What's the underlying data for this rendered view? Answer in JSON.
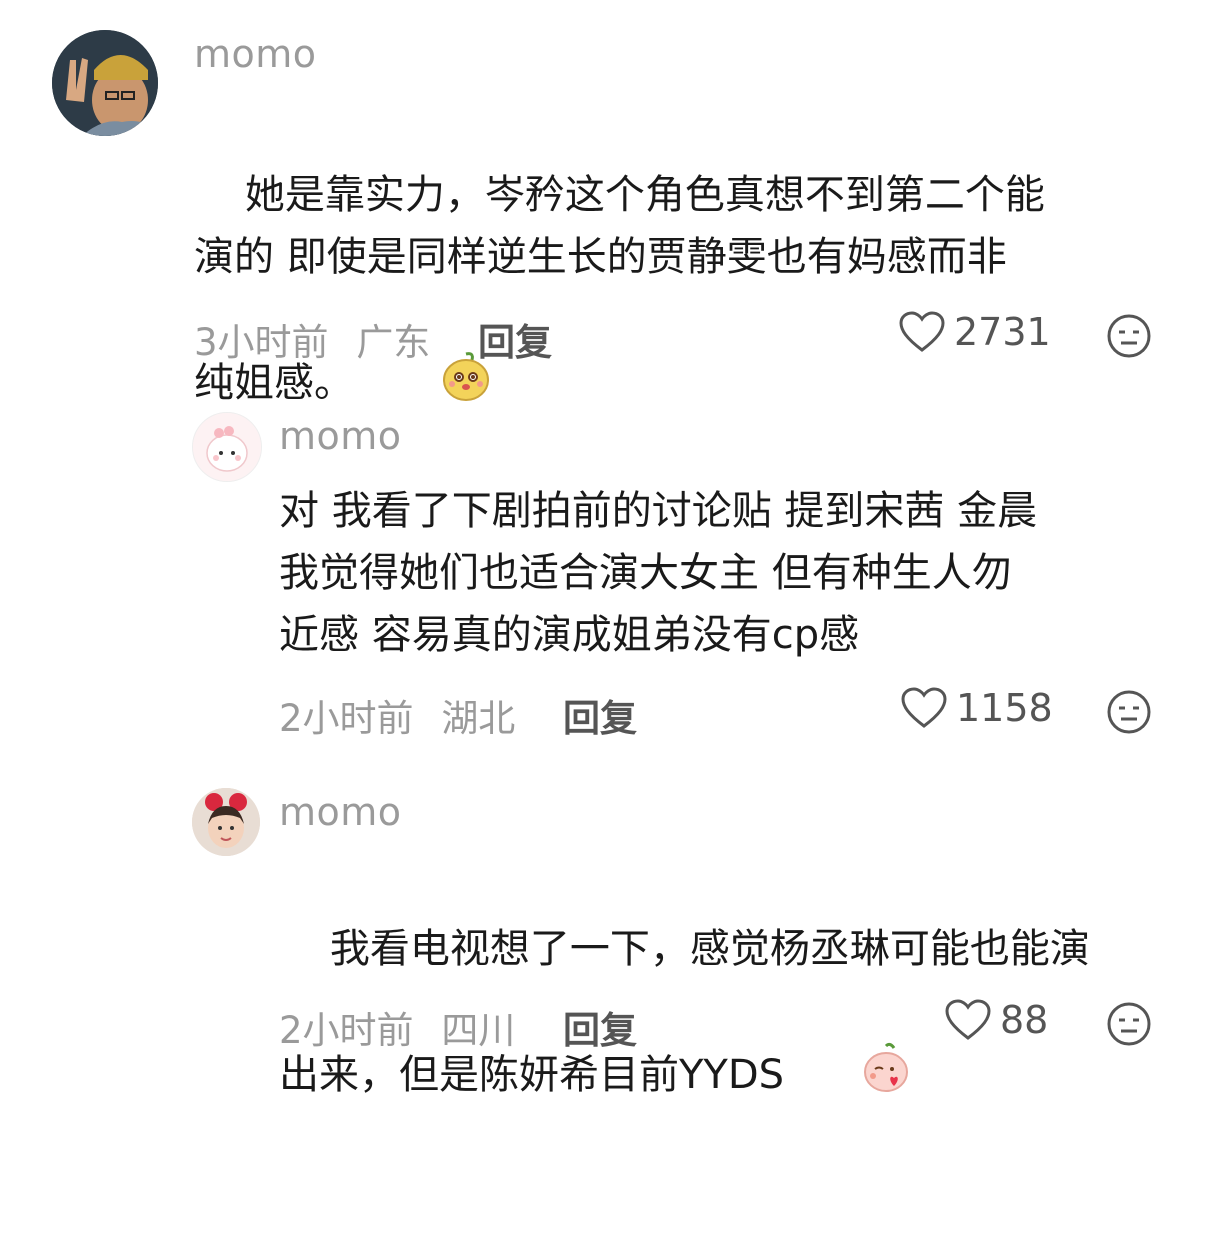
{
  "comments": [
    {
      "username": "momo",
      "content": "她是靠实力，岑矜这个角色真想不到第二个能\n演的 即使是同样逆生长的贾静雯也有妈感而非\n纯姐感。",
      "time": "3小时前",
      "location": "广东",
      "reply_label": "回复",
      "likes": "2731",
      "emoji": "happy-face-sticker"
    },
    {
      "username": "momo",
      "content": "对 我看了下剧拍前的讨论贴 提到宋茜 金晨\n我觉得她们也适合演大女主 但有种生人勿\n近感 容易真的演成姐弟没有cp感",
      "time": "2小时前",
      "location": "湖北",
      "reply_label": "回复",
      "likes": "1158"
    },
    {
      "username": "momo",
      "content": "我看电视想了一下，感觉杨丞琳可能也能演\n出来，但是陈妍希目前YYDS",
      "time": "2小时前",
      "location": "四川",
      "reply_label": "回复",
      "likes": "88",
      "emoji": "kiss-face-sticker"
    }
  ],
  "colors": {
    "text": "#1a1a1a",
    "meta": "#9a9a9a",
    "reply": "#555555"
  }
}
